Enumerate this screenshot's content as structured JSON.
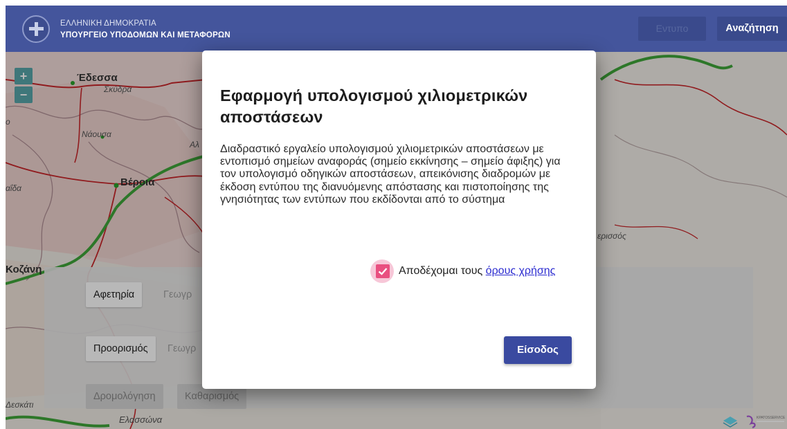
{
  "header": {
    "line1": "ΕΛΛΗΝΙΚΗ ΔΗΜΟΚΡΑΤΙΑ",
    "line2": "ΥΠΟΥΡΓΕΙΟ ΥΠΟΔΟΜΩΝ ΚΑΙ ΜΕΤΑΦΟΡΩΝ",
    "print_label": "Εντυπο",
    "search_label": "Αναζήτηση"
  },
  "map": {
    "zoom_in": "+",
    "zoom_out": "−",
    "places": [
      "Έδεσσα",
      "Σκύδρα",
      "Νάουσα",
      "Αλ",
      "Βέροια",
      "αΐδα",
      "Κοζάνη",
      "Δεσκάτι",
      "Ελασσώνα",
      "ερισσός",
      "ο"
    ]
  },
  "form": {
    "origin_label": "Αφετηρία",
    "origin_placeholder": "Γεωγρ",
    "destination_label": "Προορισμός",
    "destination_placeholder": "Γεωγρ",
    "route_label": "Δρομολόγηση",
    "clear_label": "Καθαρισμός"
  },
  "modal": {
    "title": "Εφαρμογή υπολογισμού χιλιομετρικών αποστάσεων",
    "description": "Διαδραστικό εργαλείο υπολογισμού χιλιομετρικών αποστάσεων με εντοπισμό σημείων αναφοράς (σημείο εκκίνησης – σημείο άφιξης) για τον υπολογισμό οδηγικών αποστάσεων, απεικόνισης διαδρομών με έκδοση εντύπου της διανυόμενης απόστασης και πιστοποίησης της γνησιότητας των εντύπων που εκδίδονται από το σύστημα",
    "accept_text": "Αποδέχομαι τους",
    "terms_link": "όρους χρήσης",
    "accepted": true,
    "login_label": "Είσοδος"
  },
  "footer": {
    "partner_text": "KPATOSSERVICE"
  },
  "colors": {
    "header_bg": "#44559c",
    "accent": "#3a4aa0",
    "checkbox": "#e94f80",
    "link": "#2c2cd0"
  }
}
